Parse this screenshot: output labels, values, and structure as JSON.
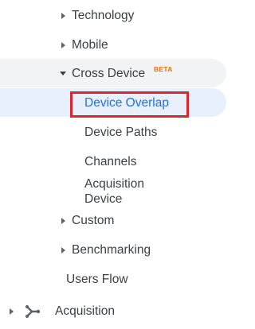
{
  "nav": {
    "items": [
      {
        "label": "Technology"
      },
      {
        "label": "Mobile"
      },
      {
        "label": "Cross Device",
        "badge": "BETA"
      },
      {
        "label": "Device Overlap"
      },
      {
        "label": "Device Paths"
      },
      {
        "label": "Channels"
      },
      {
        "label": "Acquisition\nDevice"
      },
      {
        "label": "Custom"
      },
      {
        "label": "Benchmarking"
      },
      {
        "label": "Users Flow"
      },
      {
        "label": "Acquisition"
      }
    ],
    "colors": {
      "selected_text": "#1a73e8",
      "selected_bg": "#e8f0fe",
      "open_bg": "#f1f3f4",
      "highlight_border": "#e1232b",
      "beta": "#e8710a"
    }
  }
}
